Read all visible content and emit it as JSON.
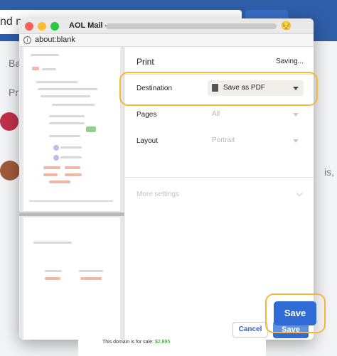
{
  "background": {
    "search_fragment": "nd m",
    "left_fragments": [
      "Ba",
      "Pr"
    ],
    "right_fragment": "is,"
  },
  "window": {
    "title": "AOL Mail -",
    "title_emoji": "😔",
    "url": "about:blank"
  },
  "print": {
    "title": "Print",
    "status": "Saving...",
    "destination": {
      "label": "Destination",
      "value": "Save as PDF"
    },
    "pages": {
      "label": "Pages",
      "value": "All"
    },
    "layout": {
      "label": "Layout",
      "value": "Portrait"
    },
    "more_settings": "More settings",
    "cancel_label": "Cancel",
    "save_label": "Save"
  },
  "highlight": {
    "save_label": "Save"
  },
  "footer": {
    "domain_text": "This domain is for sale:",
    "price": "$2,895"
  },
  "colors": {
    "accent": "#2f6bd6",
    "highlight_ring": "#f5b63a",
    "header_blue": "#2f5ea8"
  }
}
